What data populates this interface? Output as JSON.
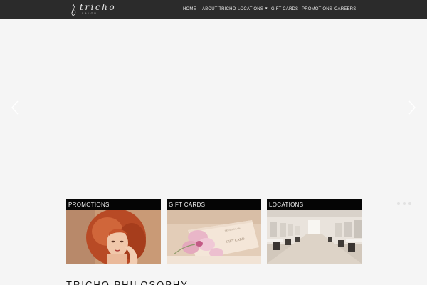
{
  "brand": {
    "name": "tricho",
    "tagline": "SALON"
  },
  "nav": {
    "items": [
      {
        "label": "HOME"
      },
      {
        "label": "ABOUT TRICHO"
      },
      {
        "label": "LOCATIONS",
        "has_dropdown": true
      },
      {
        "label": "GIFT CARDS"
      },
      {
        "label": "PROMOTIONS"
      },
      {
        "label": "CAREERS"
      }
    ]
  },
  "slider": {
    "prev_icon": "chevron-left-icon",
    "next_icon": "chevron-right-icon",
    "dot_count": 3
  },
  "cards": [
    {
      "title": "PROMOTIONS",
      "image": "red-haired-woman-photo"
    },
    {
      "title": "GIFT CARDS",
      "image": "orchid-gift-card-photo"
    },
    {
      "title": "LOCATIONS",
      "image": "salon-interior-photo"
    }
  ],
  "section": {
    "title": "TRICHO PHILOSOPHY"
  },
  "colors": {
    "navbar": "#2b2b2b",
    "background": "#f5f5f5",
    "card_header": "#050505"
  }
}
